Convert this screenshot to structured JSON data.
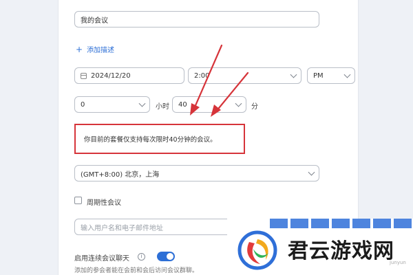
{
  "meeting": {
    "title_value": "我的会议",
    "add_description": "添加描述",
    "date": "2024/12/20",
    "time": "2:00",
    "ampm": "PM",
    "duration_hours": "0",
    "hours_unit": "小时",
    "duration_minutes": "40",
    "minutes_unit": "分",
    "plan_notice": "你目前的套餐仅支持每次限时40分钟的会议。",
    "timezone": "(GMT+8:00) 北京，上海",
    "recurring_label": "周期性会议",
    "invitee_placeholder": "输入用户名和电子邮件地址",
    "continuous_chat_label": "启用连续会议聊天",
    "continuous_chat_desc": "添加的参会者能在会前和会后访问会议群聊。",
    "continuous_chat_enabled": true
  },
  "watermark": {
    "text": "君云游戏网",
    "sub": "junyun"
  },
  "colors": {
    "accent": "#2d6fd6",
    "highlight": "#d6343a"
  },
  "icons": {
    "calendar": "calendar-icon",
    "info": "info-icon",
    "chevron": "chevron-down-icon"
  }
}
